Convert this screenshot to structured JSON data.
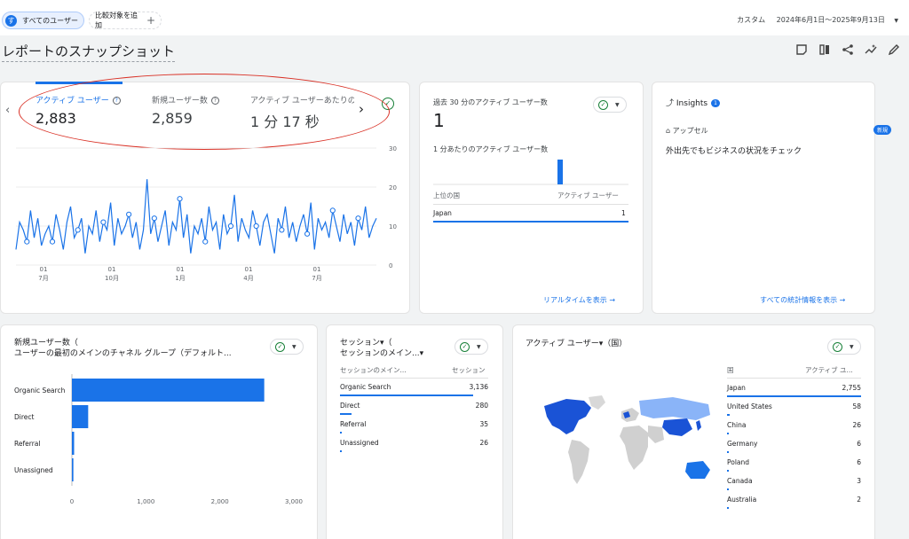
{
  "topbar": {
    "users_chip_avatar": "す",
    "users_chip": "すべてのユーザー",
    "compare_chip": "比較対象を追加",
    "range_label": "カスタム",
    "range_value": "2024年6月1日～2025年9月13日"
  },
  "page": {
    "title": "レポートのスナップショット"
  },
  "overview": {
    "metrics": [
      {
        "label": "アクティブ ユーザー",
        "value": "2,883"
      },
      {
        "label": "新規ユーザー数",
        "value": "2,859"
      },
      {
        "label": "アクティブ ユーザーあたりの",
        "value": "1 分 17 秒"
      }
    ],
    "y_ticks": [
      "30",
      "20",
      "10",
      "0"
    ],
    "x_ticks": [
      {
        "day": "01",
        "month": "7月"
      },
      {
        "day": "01",
        "month": "10月"
      },
      {
        "day": "01",
        "month": "1月"
      },
      {
        "day": "01",
        "month": "4月"
      },
      {
        "day": "01",
        "month": "7月"
      }
    ]
  },
  "realtime": {
    "label": "過去 30 分のアクティブ ユーザー数",
    "value": "1",
    "per_minute_label": "1 分あたりのアクティブ ユーザー数",
    "col_country": "上位の国",
    "col_users": "アクティブ ユーザー",
    "rows": [
      {
        "country": "Japan",
        "users": "1"
      }
    ],
    "link": "リアルタイムを表示"
  },
  "insights": {
    "title": "Insights",
    "count": "1",
    "tag": "アップセル",
    "new_badge": "新規",
    "text": "外出先でもビジネスの状況をチェック",
    "link": "すべての統計情報を表示"
  },
  "new_users": {
    "title_line1": "新規ユーザー数（",
    "title_line2": "ユーザーの最初のメインのチャネル グループ（デフォルト...",
    "x_ticks": [
      "0",
      "1,000",
      "2,000",
      "3,000"
    ]
  },
  "sessions": {
    "title_line1": "セッション▾（",
    "title_line2": "セッションのメイン...▾",
    "col_channel": "セッションのメイン...",
    "col_sessions": "セッション",
    "rows": [
      {
        "name": "Organic Search",
        "value": "3,136"
      },
      {
        "name": "Direct",
        "value": "280"
      },
      {
        "name": "Referral",
        "value": "35"
      },
      {
        "name": "Unassigned",
        "value": "26"
      }
    ]
  },
  "geo": {
    "title": "アクティブ ユーザー▾（国）",
    "col_country": "国",
    "col_users": "アクティブ ユ...",
    "rows": [
      {
        "country": "Japan",
        "users": "2,755"
      },
      {
        "country": "United States",
        "users": "58"
      },
      {
        "country": "China",
        "users": "26"
      },
      {
        "country": "Germany",
        "users": "6"
      },
      {
        "country": "Poland",
        "users": "6"
      },
      {
        "country": "Canada",
        "users": "3"
      },
      {
        "country": "Australia",
        "users": "2"
      }
    ]
  },
  "chart_data": [
    {
      "type": "line",
      "title": "",
      "ylim": [
        0,
        30
      ],
      "yticks": [
        0,
        10,
        20,
        30
      ],
      "xticks": [
        "01 7月",
        "01 10月",
        "01 1月",
        "01 4月",
        "01 7月"
      ],
      "series": [
        {
          "values": [
            4,
            11,
            9,
            6,
            14,
            7,
            12,
            5,
            8,
            10,
            6,
            13,
            9,
            4,
            11,
            15,
            7,
            9,
            12,
            3,
            10,
            8,
            14,
            6,
            11,
            9,
            16,
            5,
            12,
            8,
            10,
            13,
            7,
            11,
            4,
            9,
            22,
            8,
            12,
            6,
            10,
            14,
            5,
            11,
            9,
            17,
            7,
            13,
            3,
            10,
            8,
            12,
            6,
            15,
            9,
            11,
            4,
            13,
            8,
            10,
            18,
            6,
            12,
            9,
            7,
            14,
            10,
            5,
            11,
            13,
            8,
            3,
            12,
            9,
            15,
            7,
            11,
            6,
            10,
            13,
            8,
            16,
            4,
            12,
            9,
            11,
            7,
            14,
            10,
            6,
            13,
            8,
            11,
            5,
            12,
            9,
            15,
            7,
            10,
            12
          ]
        }
      ]
    },
    {
      "type": "bar",
      "categories": [
        "Organic Search",
        "Direct",
        "Referral",
        "Unassigned"
      ],
      "values": [
        2600,
        220,
        30,
        20
      ],
      "xlim": [
        0,
        3000
      ]
    },
    {
      "type": "bar",
      "title": "",
      "categories": [
        "1"
      ],
      "values": [
        1
      ]
    }
  ]
}
